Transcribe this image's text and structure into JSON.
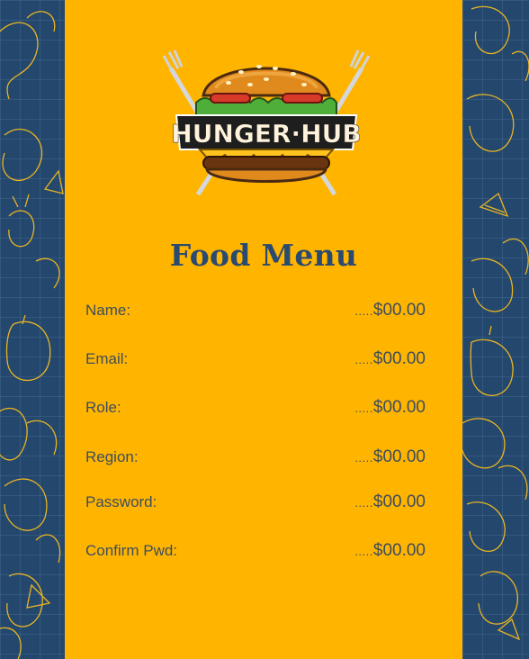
{
  "brand": {
    "logo_text": "HUNGER·HUB"
  },
  "menu": {
    "title": "Food Menu",
    "items": [
      {
        "label": "Name:",
        "dots": ".....",
        "price": "$00.00"
      },
      {
        "label": "Email:",
        "dots": ".....",
        "price": "$00.00"
      },
      {
        "label": "Role:",
        "dots": ".....",
        "price": "$00.00"
      },
      {
        "label": "Region:",
        "dots": ".....",
        "price": "$00.00"
      },
      {
        "label": "Password:",
        "dots": ".....",
        "price": "$00.00"
      },
      {
        "label": "Confirm Pwd:",
        "dots": ".....",
        "price": "$00.00"
      }
    ]
  },
  "colors": {
    "background": "#24476e",
    "card": "#ffb400",
    "title": "#2b4a6f",
    "pattern_line": "#e9b521"
  },
  "icons": [
    "burger-logo-icon",
    "fork-icon",
    "food-doodle-pattern"
  ]
}
